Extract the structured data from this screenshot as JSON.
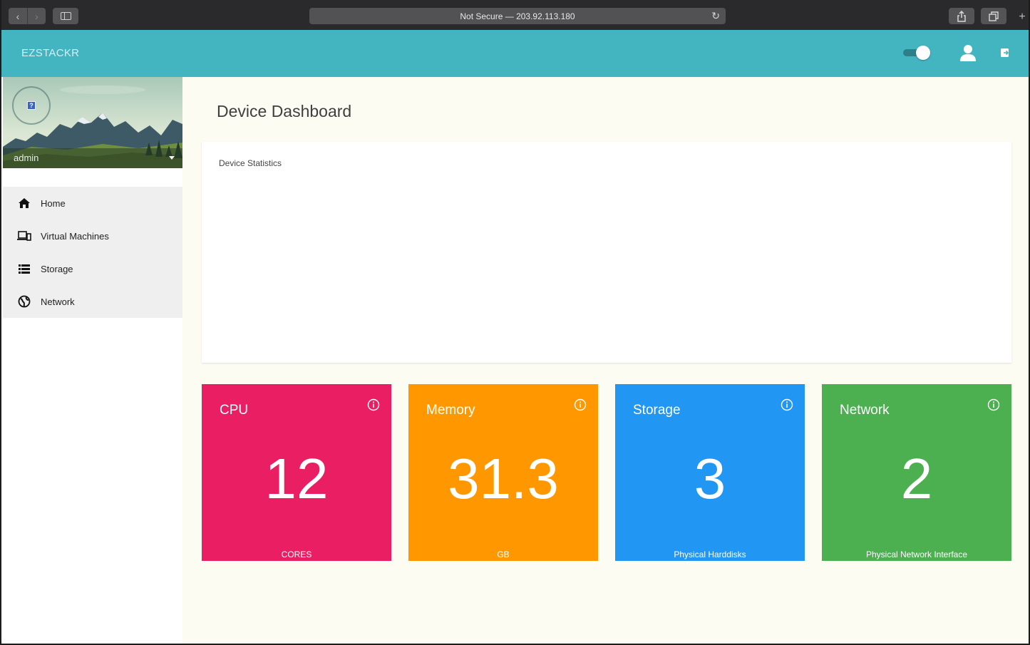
{
  "browser": {
    "address": "Not Secure — 203.92.113.180",
    "new_tab": "+"
  },
  "header": {
    "brand": "EZSTACKR",
    "toggle_on": true
  },
  "sidebar": {
    "username": "admin",
    "menu": [
      {
        "label": "Home",
        "icon": "home-icon"
      },
      {
        "label": "Virtual Machines",
        "icon": "laptop-icon"
      },
      {
        "label": "Storage",
        "icon": "storage-list-icon"
      },
      {
        "label": "Network",
        "icon": "globe-icon"
      }
    ]
  },
  "main": {
    "title": "Device Dashboard",
    "stats_card_title": "Device Statistics",
    "tiles": [
      {
        "title": "CPU",
        "value": "12",
        "unit": "CORES",
        "color": "#e91e63"
      },
      {
        "title": "Memory",
        "value": "31.3",
        "unit": "GB",
        "color": "#ff9800"
      },
      {
        "title": "Storage",
        "value": "3",
        "unit": "Physical Harddisks",
        "color": "#2196f3"
      },
      {
        "title": "Network",
        "value": "2",
        "unit": "Physical Network Interface",
        "color": "#4caf50"
      }
    ]
  },
  "colors": {
    "appbar": "#43b5c1",
    "main_background": "#fdfcf3",
    "menu_background": "#efefef"
  }
}
